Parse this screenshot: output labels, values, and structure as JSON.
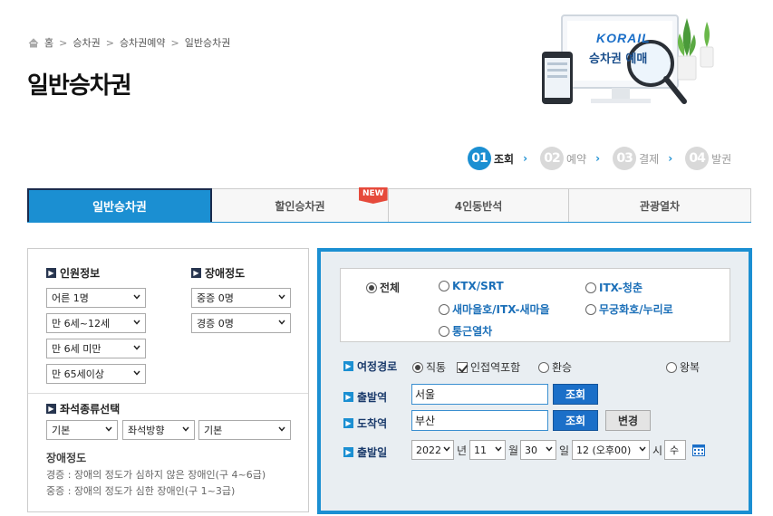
{
  "breadcrumb": {
    "items": [
      "홈",
      "승차권",
      "승차권예약",
      "일반승차권"
    ]
  },
  "page_title": "일반승차권",
  "banner": {
    "logo": "KORAIL",
    "caption": "승차권 예매"
  },
  "steps": [
    {
      "num": "01",
      "label": "조회"
    },
    {
      "num": "02",
      "label": "예약"
    },
    {
      "num": "03",
      "label": "결제"
    },
    {
      "num": "04",
      "label": "발권"
    }
  ],
  "tabs": [
    {
      "label": "일반승차권"
    },
    {
      "label": "할인승차권",
      "badge": "NEW"
    },
    {
      "label": "4인동반석"
    },
    {
      "label": "관광열차"
    }
  ],
  "passengers": {
    "title": "인원정보",
    "selects": [
      "어른 1명",
      "만 6세~12세",
      "만 6세 미만",
      "만 65세이상"
    ]
  },
  "disability": {
    "title": "장애정도",
    "selects": [
      "중증 0명",
      "경증 0명"
    ]
  },
  "seat": {
    "title": "좌석종류선택",
    "selects": [
      "기본",
      "좌석방향",
      "기본"
    ]
  },
  "note": {
    "title": "장애정도",
    "lines": [
      "경증 : 장애의 정도가 심하지 않은 장애인(구 4~6급)",
      "중증 : 장애의 정도가 심한 장애인(구 1~3급)"
    ]
  },
  "train_types": [
    "전체",
    "KTX/SRT",
    "ITX-청춘",
    "새마을호/ITX-새마을",
    "무궁화호/누리로",
    "통근열차"
  ],
  "route": {
    "label": "여정경로",
    "options": [
      "직통",
      "인접역포함",
      "환승",
      "왕복"
    ]
  },
  "departure": {
    "label": "출발역",
    "value": "서울",
    "button": "조회"
  },
  "arrival": {
    "label": "도착역",
    "value": "부산",
    "button": "조회",
    "swap": "변경"
  },
  "date": {
    "label": "출발일",
    "year": "2022",
    "year_unit": "년",
    "month": "11",
    "month_unit": "월",
    "day": "30",
    "day_unit": "일",
    "hour": "12 (오후00)",
    "hour_unit": "시",
    "weekday": "수"
  },
  "colors": {
    "accent": "#1b8fd2",
    "step_inactive": "#d9d9d9",
    "button": "#1b6fc8"
  }
}
